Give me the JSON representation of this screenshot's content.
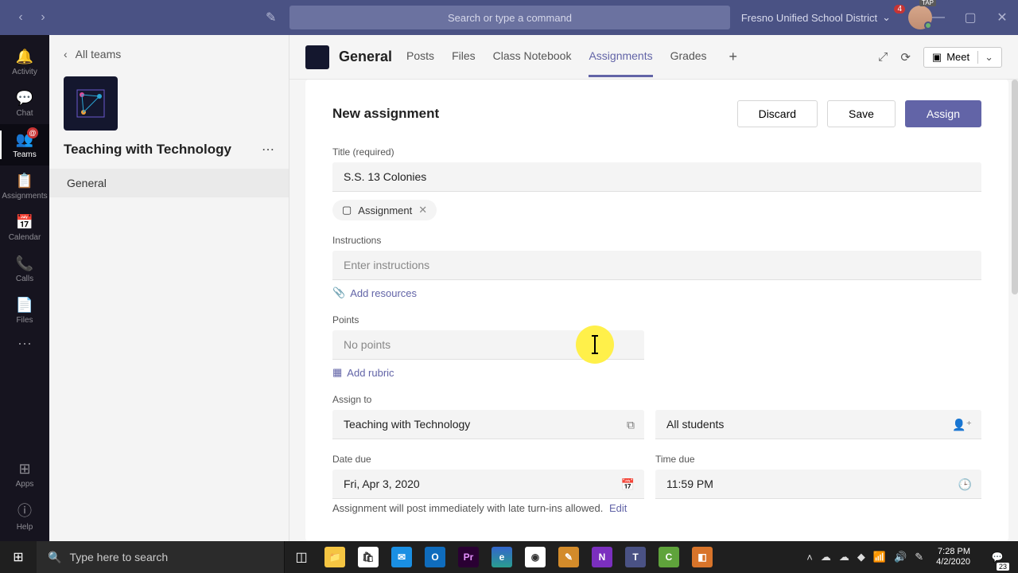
{
  "titlebar": {
    "search_placeholder": "Search or type a command",
    "org_label": "Fresno Unified School District",
    "org_badge": "4",
    "avatar_tag": "TAP"
  },
  "rail": {
    "items": [
      {
        "label": "Activity",
        "icon": "🔔"
      },
      {
        "label": "Chat",
        "icon": "💬"
      },
      {
        "label": "Teams",
        "icon": "👥"
      },
      {
        "label": "Assignments",
        "icon": "📋"
      },
      {
        "label": "Calendar",
        "icon": "📅"
      },
      {
        "label": "Calls",
        "icon": "📞"
      },
      {
        "label": "Files",
        "icon": "📄"
      }
    ],
    "teams_badge": "@",
    "apps_label": "Apps",
    "help_label": "Help"
  },
  "panel": {
    "all_teams": "All teams",
    "team_name": "Teaching with Technology",
    "channel": "General"
  },
  "tabs": {
    "channel_title": "General",
    "list": [
      "Posts",
      "Files",
      "Class Notebook",
      "Assignments",
      "Grades"
    ],
    "meet": "Meet"
  },
  "form": {
    "heading": "New assignment",
    "discard": "Discard",
    "save": "Save",
    "assign": "Assign",
    "title_label": "Title (required)",
    "title_value": "S.S. 13 Colonies",
    "tag_label": "Assignment",
    "instructions_label": "Instructions",
    "instructions_placeholder": "Enter instructions",
    "add_resources": "Add resources",
    "points_label": "Points",
    "points_placeholder": "No points",
    "add_rubric": "Add rubric",
    "assign_to_label": "Assign to",
    "assign_class": "Teaching with Technology",
    "assign_students": "All students",
    "date_due_label": "Date due",
    "date_due_value": "Fri, Apr 3, 2020",
    "time_due_label": "Time due",
    "time_due_value": "11:59 PM",
    "post_note": "Assignment will post immediately with late turn-ins allowed.",
    "edit": "Edit"
  },
  "taskbar": {
    "search_placeholder": "Type here to search",
    "time": "7:28 PM",
    "date": "4/2/2020",
    "notif_count": "23"
  }
}
